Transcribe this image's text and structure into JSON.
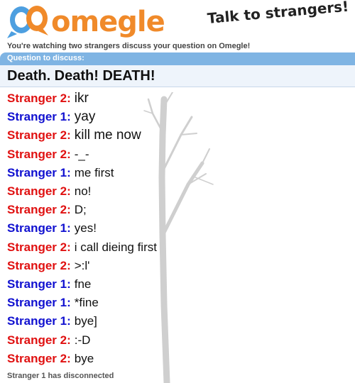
{
  "header": {
    "logo_text": "omegle",
    "tagline": "Talk to strangers!"
  },
  "subtitle": "You're watching two strangers discuss your question on Omegle!",
  "question": {
    "label": "Question to discuss:",
    "text": "Death. Death! DEATH!"
  },
  "colors": {
    "stranger1": "#1010d0",
    "stranger2": "#e01010",
    "question_bar": "#7fb4e3",
    "logo_orange": "#f08a2a",
    "logo_blue": "#4d9fe0"
  },
  "messages": [
    {
      "speaker": "Stranger 2:",
      "who": 2,
      "text": "ikr"
    },
    {
      "speaker": "Stranger 1:",
      "who": 1,
      "text": "yay"
    },
    {
      "speaker": "Stranger 2:",
      "who": 2,
      "text": "kill me now"
    },
    {
      "speaker": "Stranger 2:",
      "who": 2,
      "text": "-_-"
    },
    {
      "speaker": "Stranger 1:",
      "who": 1,
      "text": "me first"
    },
    {
      "speaker": "Stranger 2:",
      "who": 2,
      "text": "no!"
    },
    {
      "speaker": "Stranger 2:",
      "who": 2,
      "text": "D;"
    },
    {
      "speaker": "Stranger 1:",
      "who": 1,
      "text": "yes!"
    },
    {
      "speaker": "Stranger 2:",
      "who": 2,
      "text": "i call dieing first"
    },
    {
      "speaker": "Stranger 2:",
      "who": 2,
      "text": ">:l'"
    },
    {
      "speaker": "Stranger 1:",
      "who": 1,
      "text": "fne"
    },
    {
      "speaker": "Stranger 1:",
      "who": 1,
      "text": "*fine"
    },
    {
      "speaker": "Stranger 1:",
      "who": 1,
      "text": "bye]"
    },
    {
      "speaker": "Stranger 2:",
      "who": 2,
      "text": ":-D"
    },
    {
      "speaker": "Stranger 2:",
      "who": 2,
      "text": "bye"
    }
  ],
  "status": "Stranger 1 has disconnected"
}
